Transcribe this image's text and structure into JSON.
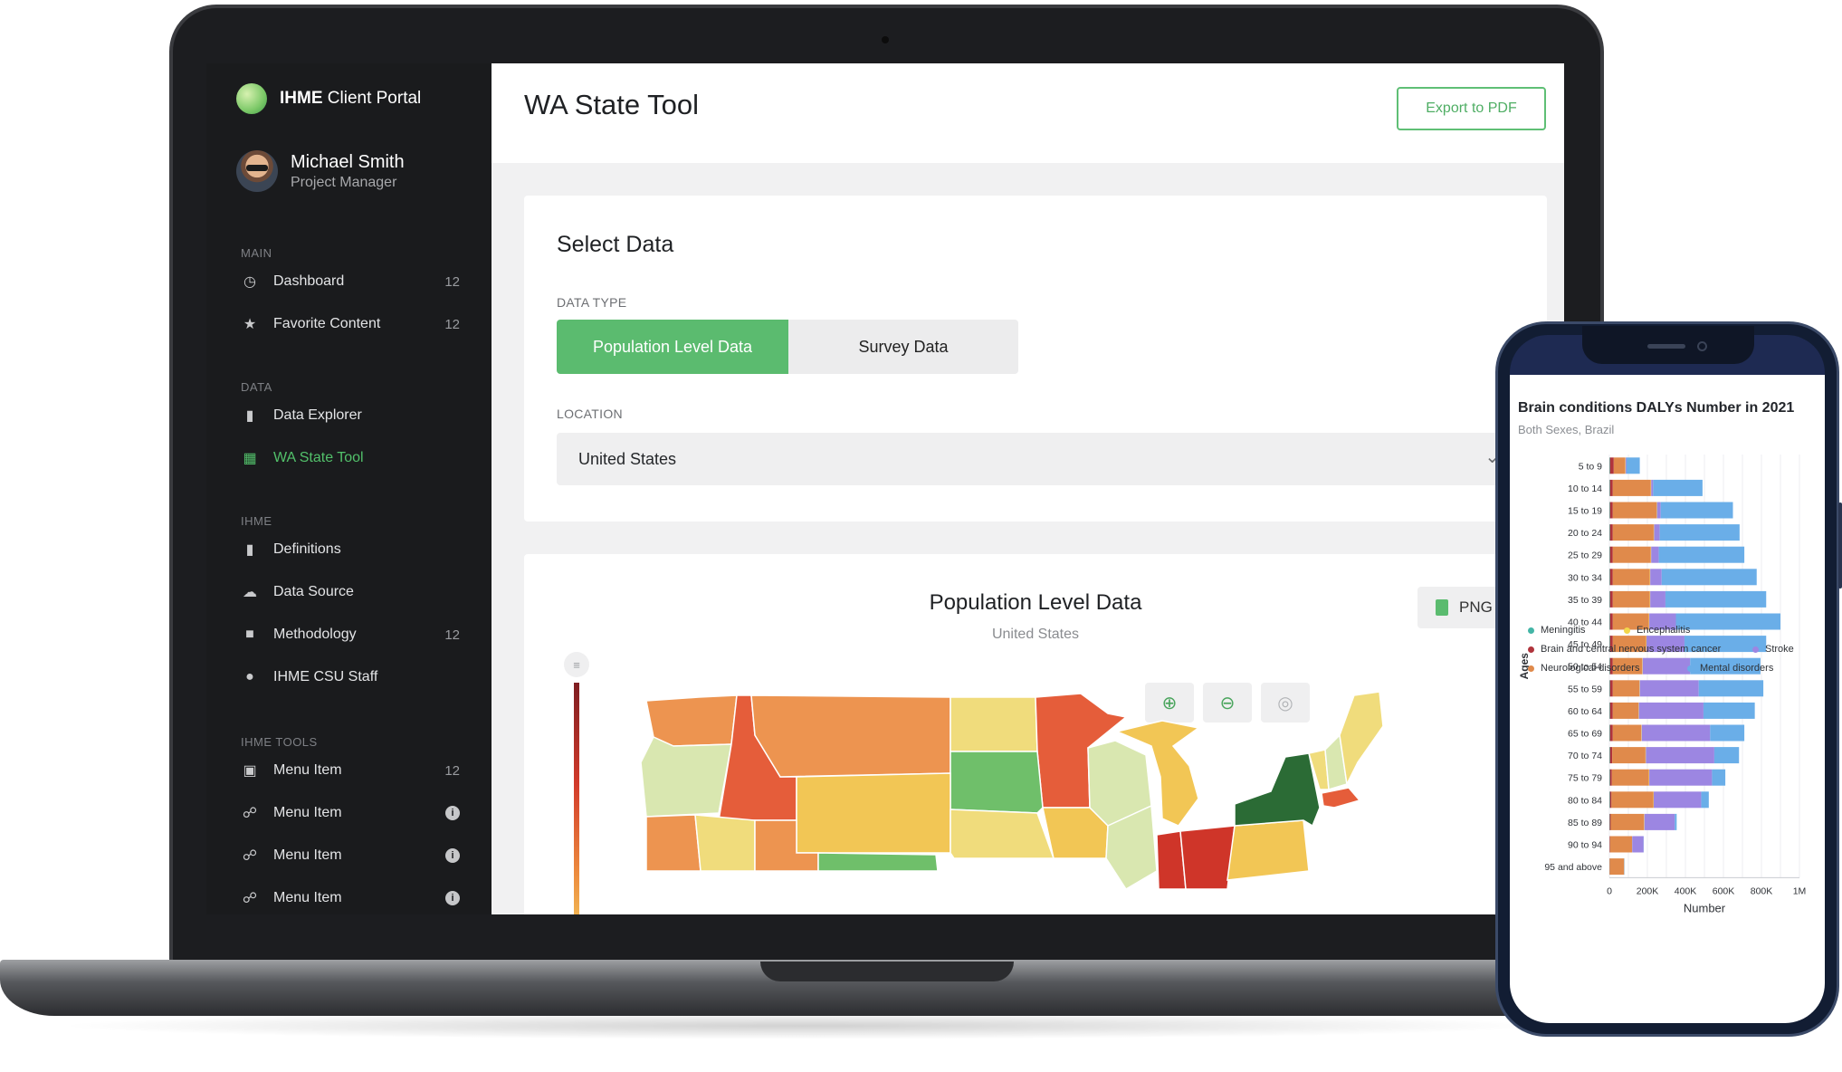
{
  "app": {
    "brand_bold": "IHME",
    "brand_rest": " Client Portal",
    "user_name": "Michael Smith",
    "user_role": "Project Manager"
  },
  "sidebar": {
    "sections": [
      {
        "title": "MAIN",
        "items": [
          {
            "label": "Dashboard",
            "icon": "clock-icon",
            "count": "12"
          },
          {
            "label": "Favorite Content",
            "icon": "star-icon",
            "count": "12"
          }
        ]
      },
      {
        "title": "DATA",
        "items": [
          {
            "label": "Data Explorer",
            "icon": "bar-chart-icon"
          },
          {
            "label": "WA State Tool",
            "icon": "map-icon",
            "active": true
          }
        ]
      },
      {
        "title": "IHME",
        "items": [
          {
            "label": "Definitions",
            "icon": "document-icon"
          },
          {
            "label": "Data Source",
            "icon": "cloud-icon"
          },
          {
            "label": "Methodology",
            "icon": "folder-icon",
            "count": "12"
          },
          {
            "label": "IHME CSU Staff",
            "icon": "person-icon"
          }
        ]
      },
      {
        "title": "IHME TOOLS",
        "items": [
          {
            "label": "Menu Item",
            "icon": "lock-icon",
            "count": "12"
          },
          {
            "label": "Menu Item",
            "icon": "link-icon",
            "info": "i"
          },
          {
            "label": "Menu Item",
            "icon": "link-icon",
            "info": "i"
          },
          {
            "label": "Menu Item",
            "icon": "link-icon",
            "info": "i"
          }
        ]
      }
    ]
  },
  "page": {
    "title": "WA State Tool",
    "export_label": "Export to PDF"
  },
  "select_data": {
    "title": "Select Data",
    "data_type_label": "DATA TYPE",
    "options": [
      "Population Level Data",
      "Survey Data"
    ],
    "selected": "Population Level Data",
    "location_label": "LOCATION",
    "location_value": "United States"
  },
  "map_panel": {
    "title": "Population Level Data",
    "subtitle": "United States",
    "png_label": "PNG",
    "zoom_in_icon": "zoom-in-icon",
    "zoom_out_icon": "zoom-out-icon",
    "locate_icon": "target-icon",
    "colors": {
      "dark_green": "#2b6b35",
      "green": "#6fbf6a",
      "light_green": "#d9e7b0",
      "yellow": "#f0dc7c",
      "gold": "#f2c655",
      "orange": "#ed9450",
      "red_orange": "#e55d3a",
      "red": "#cf3529"
    }
  },
  "phone_chart": {
    "chart_data": {
      "type": "bar",
      "orientation": "horizontal",
      "stacked": true,
      "title": "Brain conditions DALYs Number in 2021",
      "subtitle": "Both Sexes, Brazil",
      "xlabel": "Number",
      "ylabel": "Ages",
      "xlim": [
        0,
        1000000
      ],
      "xticks": [
        "0",
        "200K",
        "400K",
        "600K",
        "800K",
        "1M"
      ],
      "categories": [
        "5 to 9",
        "10 to 14",
        "15 to 19",
        "20 to 24",
        "25 to 29",
        "30 to 34",
        "35 to 39",
        "40 to 44",
        "45 to 49",
        "50 to 54",
        "55 to 59",
        "60 to 64",
        "65 to 69",
        "70 to 74",
        "75 to 79",
        "80 to 84",
        "85 to 89",
        "90 to 94",
        "95 and above"
      ],
      "series": [
        {
          "name": "Meningitis",
          "color": "#43b5a6",
          "values": [
            3000,
            3000,
            3000,
            3000,
            3000,
            3000,
            3000,
            3000,
            3000,
            3000,
            3000,
            3000,
            3000,
            3000,
            3000,
            3000,
            2000,
            1000,
            1000
          ]
        },
        {
          "name": "Brain and central nervous system cancer",
          "color": "#b0343c",
          "values": [
            20000,
            15000,
            15000,
            15000,
            15000,
            15000,
            15000,
            15000,
            15000,
            15000,
            15000,
            15000,
            15000,
            12000,
            10000,
            8000,
            5000,
            3000,
            1000
          ]
        },
        {
          "name": "Neurological disorders",
          "color": "#e08a4b",
          "values": [
            60000,
            200000,
            230000,
            215000,
            200000,
            195000,
            195000,
            190000,
            175000,
            155000,
            140000,
            135000,
            150000,
            175000,
            195000,
            220000,
            175000,
            115000,
            75000
          ]
        },
        {
          "name": "Encephalitis",
          "color": "#f2d64b",
          "values": [
            2000,
            2000,
            2000,
            2000,
            2000,
            2000,
            2000,
            2000,
            2000,
            2000,
            2000,
            2000,
            2000,
            2000,
            2000,
            2000,
            2000,
            1000,
            1000
          ]
        },
        {
          "name": "Stroke",
          "color": "#9c86e2",
          "values": [
            5000,
            10000,
            20000,
            30000,
            40000,
            60000,
            80000,
            140000,
            200000,
            250000,
            310000,
            340000,
            360000,
            360000,
            330000,
            250000,
            160000,
            60000,
            1000
          ]
        },
        {
          "name": "Mental disorders",
          "color": "#6aaee8",
          "values": [
            70000,
            260000,
            380000,
            420000,
            450000,
            500000,
            530000,
            550000,
            430000,
            370000,
            340000,
            270000,
            180000,
            130000,
            70000,
            40000,
            10000,
            1000,
            1000
          ]
        }
      ],
      "legend_position": "bottom",
      "grid": true
    }
  }
}
